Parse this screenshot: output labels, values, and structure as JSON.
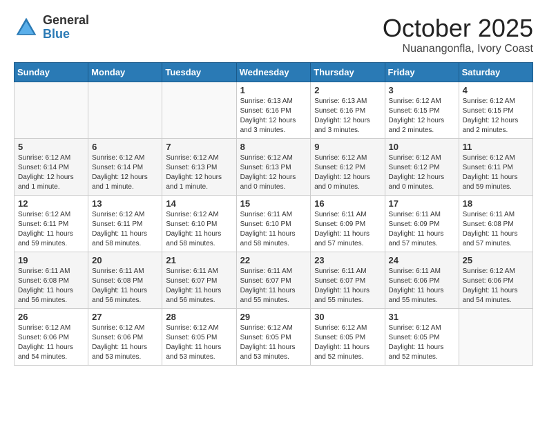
{
  "logo": {
    "general": "General",
    "blue": "Blue"
  },
  "title": "October 2025",
  "location": "Nuanangonfla, Ivory Coast",
  "weekdays": [
    "Sunday",
    "Monday",
    "Tuesday",
    "Wednesday",
    "Thursday",
    "Friday",
    "Saturday"
  ],
  "weeks": [
    [
      {
        "day": "",
        "info": ""
      },
      {
        "day": "",
        "info": ""
      },
      {
        "day": "",
        "info": ""
      },
      {
        "day": "1",
        "info": "Sunrise: 6:13 AM\nSunset: 6:16 PM\nDaylight: 12 hours\nand 3 minutes."
      },
      {
        "day": "2",
        "info": "Sunrise: 6:13 AM\nSunset: 6:16 PM\nDaylight: 12 hours\nand 3 minutes."
      },
      {
        "day": "3",
        "info": "Sunrise: 6:12 AM\nSunset: 6:15 PM\nDaylight: 12 hours\nand 2 minutes."
      },
      {
        "day": "4",
        "info": "Sunrise: 6:12 AM\nSunset: 6:15 PM\nDaylight: 12 hours\nand 2 minutes."
      }
    ],
    [
      {
        "day": "5",
        "info": "Sunrise: 6:12 AM\nSunset: 6:14 PM\nDaylight: 12 hours\nand 1 minute."
      },
      {
        "day": "6",
        "info": "Sunrise: 6:12 AM\nSunset: 6:14 PM\nDaylight: 12 hours\nand 1 minute."
      },
      {
        "day": "7",
        "info": "Sunrise: 6:12 AM\nSunset: 6:13 PM\nDaylight: 12 hours\nand 1 minute."
      },
      {
        "day": "8",
        "info": "Sunrise: 6:12 AM\nSunset: 6:13 PM\nDaylight: 12 hours\nand 0 minutes."
      },
      {
        "day": "9",
        "info": "Sunrise: 6:12 AM\nSunset: 6:12 PM\nDaylight: 12 hours\nand 0 minutes."
      },
      {
        "day": "10",
        "info": "Sunrise: 6:12 AM\nSunset: 6:12 PM\nDaylight: 12 hours\nand 0 minutes."
      },
      {
        "day": "11",
        "info": "Sunrise: 6:12 AM\nSunset: 6:11 PM\nDaylight: 11 hours\nand 59 minutes."
      }
    ],
    [
      {
        "day": "12",
        "info": "Sunrise: 6:12 AM\nSunset: 6:11 PM\nDaylight: 11 hours\nand 59 minutes."
      },
      {
        "day": "13",
        "info": "Sunrise: 6:12 AM\nSunset: 6:11 PM\nDaylight: 11 hours\nand 58 minutes."
      },
      {
        "day": "14",
        "info": "Sunrise: 6:12 AM\nSunset: 6:10 PM\nDaylight: 11 hours\nand 58 minutes."
      },
      {
        "day": "15",
        "info": "Sunrise: 6:11 AM\nSunset: 6:10 PM\nDaylight: 11 hours\nand 58 minutes."
      },
      {
        "day": "16",
        "info": "Sunrise: 6:11 AM\nSunset: 6:09 PM\nDaylight: 11 hours\nand 57 minutes."
      },
      {
        "day": "17",
        "info": "Sunrise: 6:11 AM\nSunset: 6:09 PM\nDaylight: 11 hours\nand 57 minutes."
      },
      {
        "day": "18",
        "info": "Sunrise: 6:11 AM\nSunset: 6:08 PM\nDaylight: 11 hours\nand 57 minutes."
      }
    ],
    [
      {
        "day": "19",
        "info": "Sunrise: 6:11 AM\nSunset: 6:08 PM\nDaylight: 11 hours\nand 56 minutes."
      },
      {
        "day": "20",
        "info": "Sunrise: 6:11 AM\nSunset: 6:08 PM\nDaylight: 11 hours\nand 56 minutes."
      },
      {
        "day": "21",
        "info": "Sunrise: 6:11 AM\nSunset: 6:07 PM\nDaylight: 11 hours\nand 56 minutes."
      },
      {
        "day": "22",
        "info": "Sunrise: 6:11 AM\nSunset: 6:07 PM\nDaylight: 11 hours\nand 55 minutes."
      },
      {
        "day": "23",
        "info": "Sunrise: 6:11 AM\nSunset: 6:07 PM\nDaylight: 11 hours\nand 55 minutes."
      },
      {
        "day": "24",
        "info": "Sunrise: 6:11 AM\nSunset: 6:06 PM\nDaylight: 11 hours\nand 55 minutes."
      },
      {
        "day": "25",
        "info": "Sunrise: 6:12 AM\nSunset: 6:06 PM\nDaylight: 11 hours\nand 54 minutes."
      }
    ],
    [
      {
        "day": "26",
        "info": "Sunrise: 6:12 AM\nSunset: 6:06 PM\nDaylight: 11 hours\nand 54 minutes."
      },
      {
        "day": "27",
        "info": "Sunrise: 6:12 AM\nSunset: 6:06 PM\nDaylight: 11 hours\nand 53 minutes."
      },
      {
        "day": "28",
        "info": "Sunrise: 6:12 AM\nSunset: 6:05 PM\nDaylight: 11 hours\nand 53 minutes."
      },
      {
        "day": "29",
        "info": "Sunrise: 6:12 AM\nSunset: 6:05 PM\nDaylight: 11 hours\nand 53 minutes."
      },
      {
        "day": "30",
        "info": "Sunrise: 6:12 AM\nSunset: 6:05 PM\nDaylight: 11 hours\nand 52 minutes."
      },
      {
        "day": "31",
        "info": "Sunrise: 6:12 AM\nSunset: 6:05 PM\nDaylight: 11 hours\nand 52 minutes."
      },
      {
        "day": "",
        "info": ""
      }
    ]
  ]
}
